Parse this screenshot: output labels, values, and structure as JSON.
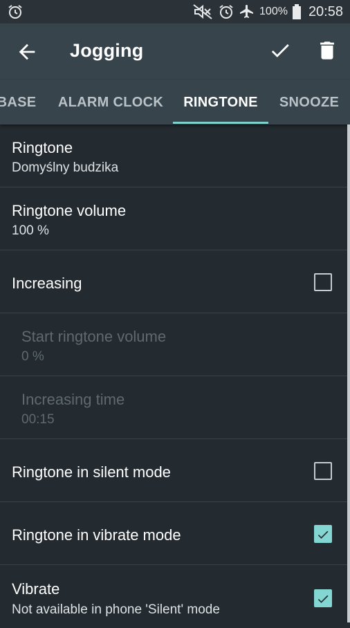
{
  "status_bar": {
    "battery_percent": "100%",
    "time": "20:58",
    "icons": [
      "alarm-clock-icon",
      "mute-icon",
      "alarm-icon",
      "airplane-icon",
      "battery-icon"
    ]
  },
  "app_bar": {
    "title": "Jogging",
    "back_icon": "arrow-left-icon",
    "confirm_icon": "checkmark-icon",
    "delete_icon": "trash-icon"
  },
  "tabs": [
    {
      "label": "BASE",
      "active": false
    },
    {
      "label": "ALARM CLOCK",
      "active": false
    },
    {
      "label": "RINGTONE",
      "active": true
    },
    {
      "label": "SNOOZE",
      "active": false
    }
  ],
  "colors": {
    "accent": "#7fd1cd",
    "toolbar": "#37444c",
    "background": "#232a30"
  },
  "settings": [
    {
      "title": "Ringtone",
      "summary": "Domyślny budzika"
    },
    {
      "title": "Ringtone volume",
      "summary": "100 %"
    },
    {
      "title": "Increasing",
      "checked": false
    },
    {
      "title": "Start ringtone volume",
      "summary": "0 %",
      "enabled": false
    },
    {
      "title": "Increasing time",
      "summary": "00:15",
      "enabled": false
    },
    {
      "title": "Ringtone in silent mode",
      "checked": false
    },
    {
      "title": "Ringtone in vibrate mode",
      "checked": true
    },
    {
      "title": "Vibrate",
      "summary": "Not available in phone 'Silent' mode",
      "checked": true
    }
  ]
}
